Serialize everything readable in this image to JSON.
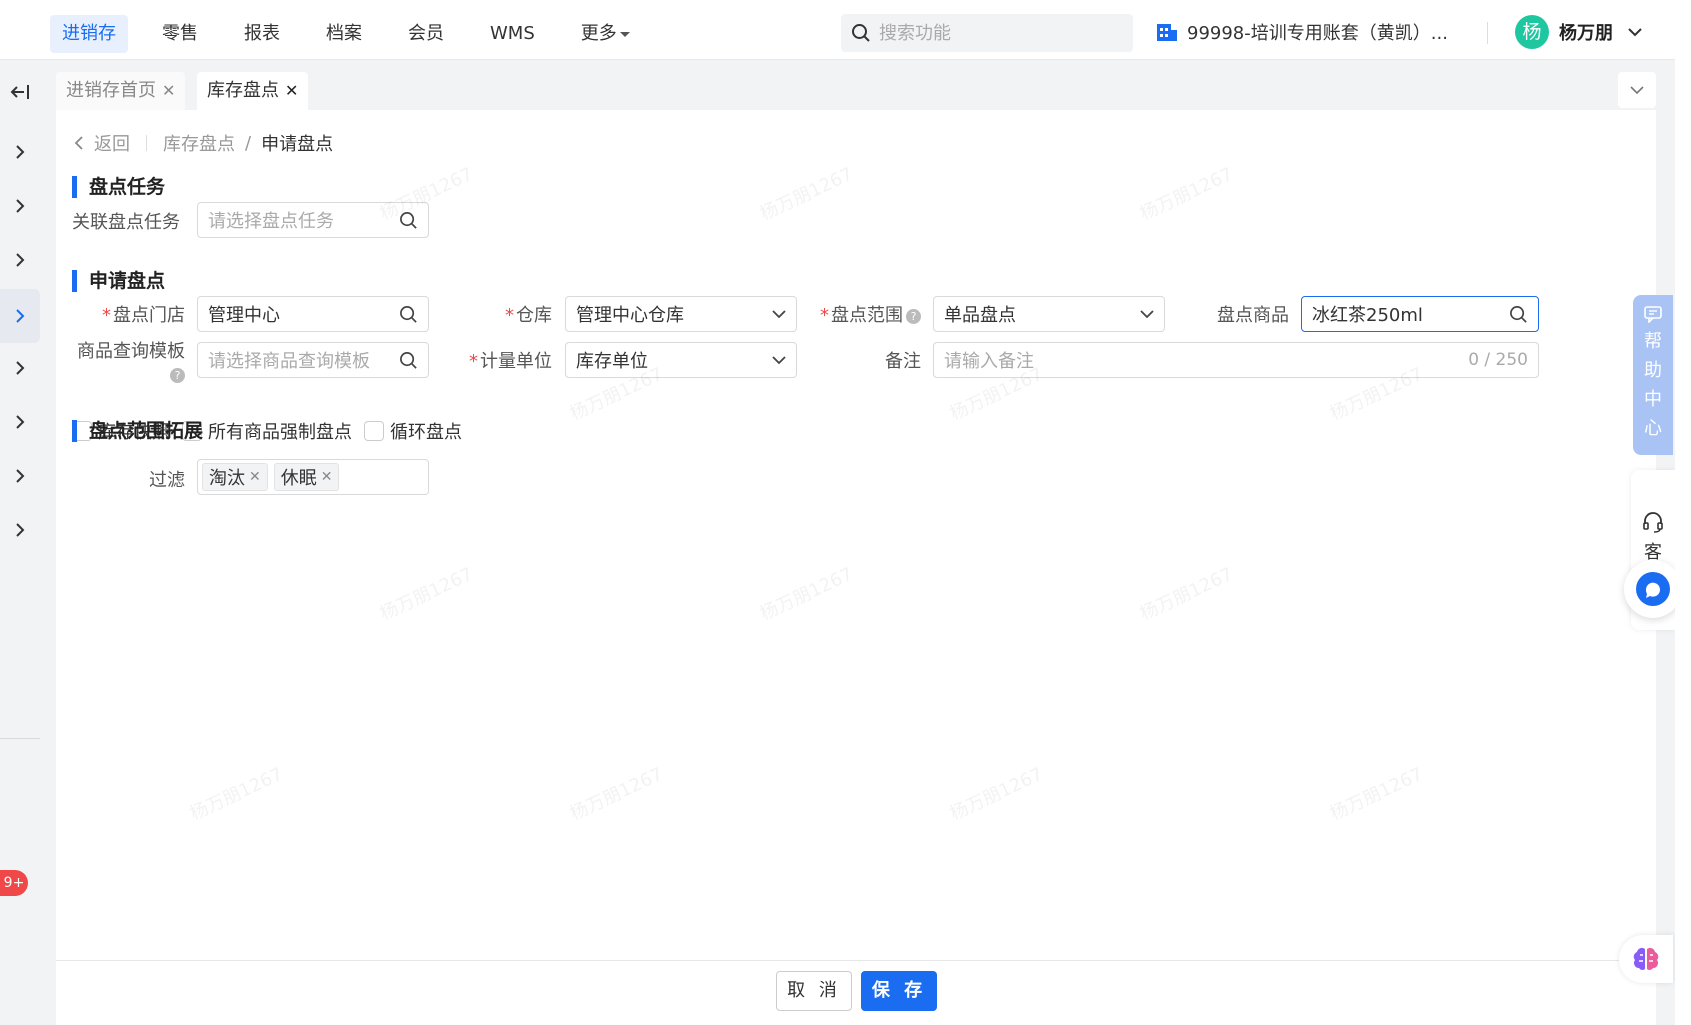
{
  "topnav": {
    "items": [
      "进销存",
      "零售",
      "报表",
      "档案",
      "会员",
      "WMS",
      "更多"
    ],
    "search_placeholder": "搜索功能",
    "account": "99998-培训专用账套（黄凯）...",
    "user_avatar": "杨",
    "user_name": "杨万朋"
  },
  "tabs": [
    {
      "label": "进销存首页"
    },
    {
      "label": "库存盘点"
    }
  ],
  "breadcrumb": {
    "back": "返回",
    "parent": "库存盘点",
    "separator": "/",
    "current": "申请盘点"
  },
  "section_task": {
    "title": "盘点任务",
    "related_task_label": "关联盘点任务",
    "related_task_placeholder": "请选择盘点任务"
  },
  "section_apply": {
    "title": "申请盘点",
    "store_label": "盘点门店",
    "store_value": "管理中心",
    "warehouse_label": "仓库",
    "warehouse_value": "管理中心仓库",
    "scope_label": "盘点范围",
    "scope_value": "单品盘点",
    "product_label": "盘点商品",
    "product_value": "冰红茶250ml",
    "template_label": "商品查询模板",
    "template_placeholder": "请选择商品查询模板",
    "unit_label": "计量单位",
    "unit_value": "库存单位",
    "remark_label": "备注",
    "remark_placeholder": "请输入备注",
    "remark_counter": "0 / 250",
    "checkboxes": [
      "库存快照",
      "所有商品强制盘点",
      "循环盘点"
    ]
  },
  "section_range": {
    "title": "盘点范围拓展",
    "filter_label": "过滤",
    "filter_tags": [
      "淘汰",
      "休眠"
    ]
  },
  "footer": {
    "cancel": "取 消",
    "save": "保 存"
  },
  "widgets": {
    "help_center": [
      "帮",
      "助",
      "中",
      "心"
    ],
    "customer_service": "客"
  },
  "badge": "9+",
  "watermark": "杨万朋1267",
  "colors": {
    "accent": "#1a6cf0",
    "required": "#f04848",
    "avatar": "#1fc7a0"
  }
}
